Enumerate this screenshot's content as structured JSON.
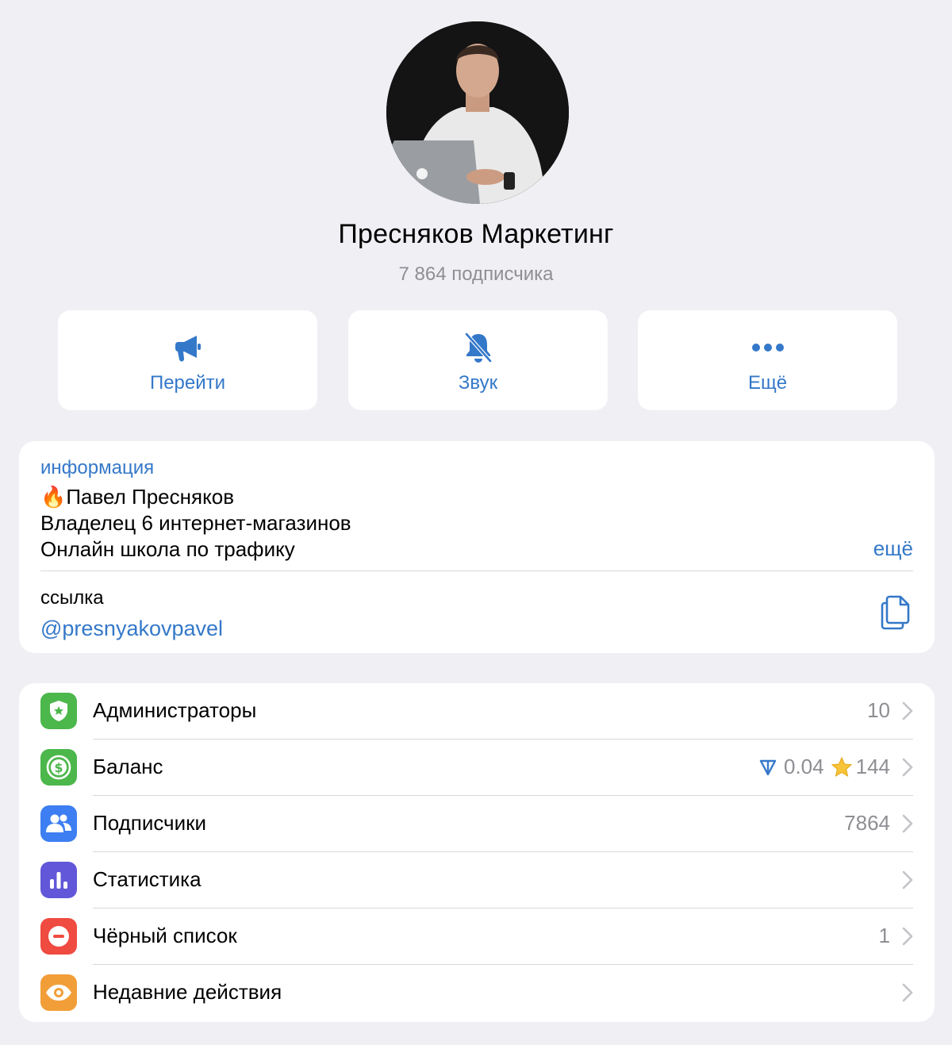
{
  "channel": {
    "name": "Пресняков Маркетинг",
    "subscribers": "7 864 подписчика"
  },
  "actions": [
    {
      "label": "Перейти",
      "icon": "megaphone-icon"
    },
    {
      "label": "Звук",
      "icon": "bell-slash-icon"
    },
    {
      "label": "Ещё",
      "icon": "more-dots-icon"
    }
  ],
  "info": {
    "header": "информация",
    "lines": [
      "🔥Павел Пресняков",
      "Владелец 6 интернет-магазинов",
      "Онлайн школа по трафику"
    ],
    "more": "ещё",
    "link_label": "ссылка",
    "link_value": "@presnyakovpavel"
  },
  "menu": [
    {
      "label": "Администраторы",
      "value": "10",
      "icon": "admin-shield-icon",
      "color": "#4cb74b"
    },
    {
      "label": "Баланс",
      "ton": "0.04",
      "stars": "144",
      "icon": "balance-dollar-icon",
      "color": "#4cb74b"
    },
    {
      "label": "Подписчики",
      "value": "7864",
      "icon": "subscribers-people-icon",
      "color": "#3d7ef2"
    },
    {
      "label": "Статистика",
      "value": "",
      "icon": "statistics-bars-icon",
      "color": "#6157d8"
    },
    {
      "label": "Чёрный список",
      "value": "1",
      "icon": "blocklist-minus-icon",
      "color": "#ef4b40"
    },
    {
      "label": "Недавние действия",
      "value": "",
      "icon": "recent-actions-eye-icon",
      "color": "#f29e38"
    }
  ],
  "colors": {
    "accent": "#3478c9",
    "background": "#efeff4",
    "secondary_text": "#8e8e93"
  }
}
